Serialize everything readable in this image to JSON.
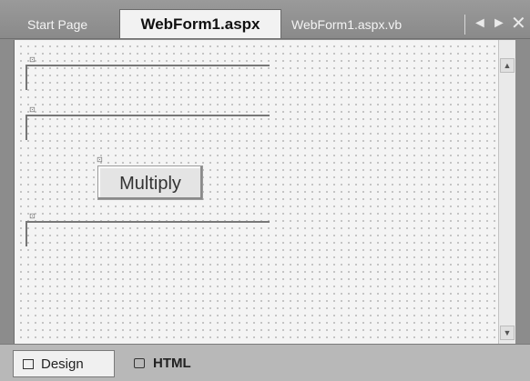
{
  "tabs": {
    "start": "Start Page",
    "active": "WebForm1.aspx",
    "vb": "WebForm1.aspx.vb",
    "prev_glyph": "◄",
    "next_glyph": "►",
    "close_glyph": "✕",
    "icon_names": [
      "scroll-left-icon",
      "scroll-right-icon",
      "close-icon"
    ]
  },
  "design": {
    "button_label": "Multiply",
    "textboxes": 3,
    "control_glyph": "⊡"
  },
  "view_tabs": {
    "design": "Design",
    "html": "HTML"
  },
  "colors": {
    "tab_active_bg": "#f2f2f2",
    "surface_bg": "#f4f4f4",
    "chrome": "#8c8c8c"
  }
}
